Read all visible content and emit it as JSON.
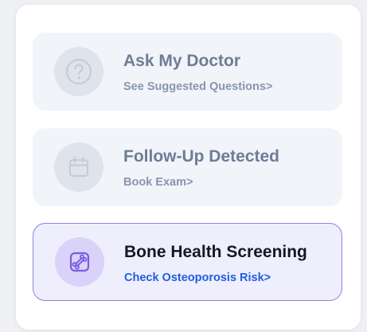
{
  "cards": [
    {
      "title": "Ask My Doctor",
      "subtitle": "See Suggested Questions>",
      "icon": "question-circle-icon",
      "active": false
    },
    {
      "title": "Follow-Up Detected",
      "subtitle": "Book Exam>",
      "icon": "calendar-icon",
      "active": false
    },
    {
      "title": "Bone Health Screening",
      "subtitle": "Check Osteoporosis Risk>",
      "icon": "bone-icon",
      "active": true
    }
  ],
  "colors": {
    "inactive_icon": "#c4ccd8",
    "active_icon": "#7a5ce0",
    "active_link": "#1f5fe0",
    "active_border": "#8d80e6"
  }
}
